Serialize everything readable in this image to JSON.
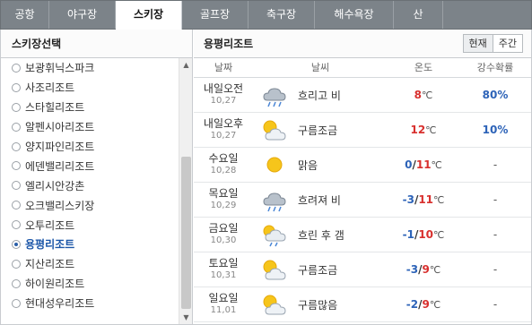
{
  "tabs": [
    {
      "label": "공항",
      "active": false
    },
    {
      "label": "야구장",
      "active": false
    },
    {
      "label": "스키장",
      "active": true
    },
    {
      "label": "골프장",
      "active": false
    },
    {
      "label": "축구장",
      "active": false
    },
    {
      "label": "해수욕장",
      "active": false
    },
    {
      "label": "산",
      "active": false
    }
  ],
  "left": {
    "title": "스키장선택",
    "items": [
      {
        "label": "보광휘닉스파크",
        "selected": false
      },
      {
        "label": "사조리조트",
        "selected": false
      },
      {
        "label": "스타힐리조트",
        "selected": false
      },
      {
        "label": "알펜시아리조트",
        "selected": false
      },
      {
        "label": "양지파인리조트",
        "selected": false
      },
      {
        "label": "에덴밸리리조트",
        "selected": false
      },
      {
        "label": "엘리시안강촌",
        "selected": false
      },
      {
        "label": "오크밸리스키장",
        "selected": false
      },
      {
        "label": "오투리조트",
        "selected": false
      },
      {
        "label": "용평리조트",
        "selected": true
      },
      {
        "label": "지산리조트",
        "selected": false
      },
      {
        "label": "하이원리조트",
        "selected": false
      },
      {
        "label": "현대성우리조트",
        "selected": false
      }
    ]
  },
  "right": {
    "title": "용평리조트",
    "toggle": {
      "current": "현재",
      "weekly": "주간"
    },
    "headers": {
      "date": "날짜",
      "weather": "날씨",
      "temp": "온도",
      "rain": "강수확률"
    },
    "rows": [
      {
        "day": "내일오전",
        "date": "10,27",
        "icon": "cloud-rain-icon",
        "weather": "흐리고 비",
        "lo": "",
        "hi": "8",
        "unit": "℃",
        "rain": "80%"
      },
      {
        "day": "내일오후",
        "date": "10,27",
        "icon": "sun-cloud-icon",
        "weather": "구름조금",
        "lo": "",
        "hi": "12",
        "unit": "℃",
        "rain": "10%"
      },
      {
        "day": "수요일",
        "date": "10,28",
        "icon": "sun-icon",
        "weather": "맑음",
        "lo": "0",
        "hi": "11",
        "unit": "℃",
        "rain": "-"
      },
      {
        "day": "목요일",
        "date": "10,29",
        "icon": "cloud-rain-icon",
        "weather": "흐려져 비",
        "lo": "-3",
        "hi": "11",
        "unit": "℃",
        "rain": "-"
      },
      {
        "day": "금요일",
        "date": "10,30",
        "icon": "sun-cloud-rain-icon",
        "weather": "흐린 후 갬",
        "lo": "-1",
        "hi": "10",
        "unit": "℃",
        "rain": "-"
      },
      {
        "day": "토요일",
        "date": "10,31",
        "icon": "sun-cloud-icon",
        "weather": "구름조금",
        "lo": "-3",
        "hi": "9",
        "unit": "℃",
        "rain": "-"
      },
      {
        "day": "일요일",
        "date": "11,01",
        "icon": "sun-cloud-icon",
        "weather": "구름많음",
        "lo": "-2",
        "hi": "9",
        "unit": "℃",
        "rain": "-"
      }
    ]
  }
}
